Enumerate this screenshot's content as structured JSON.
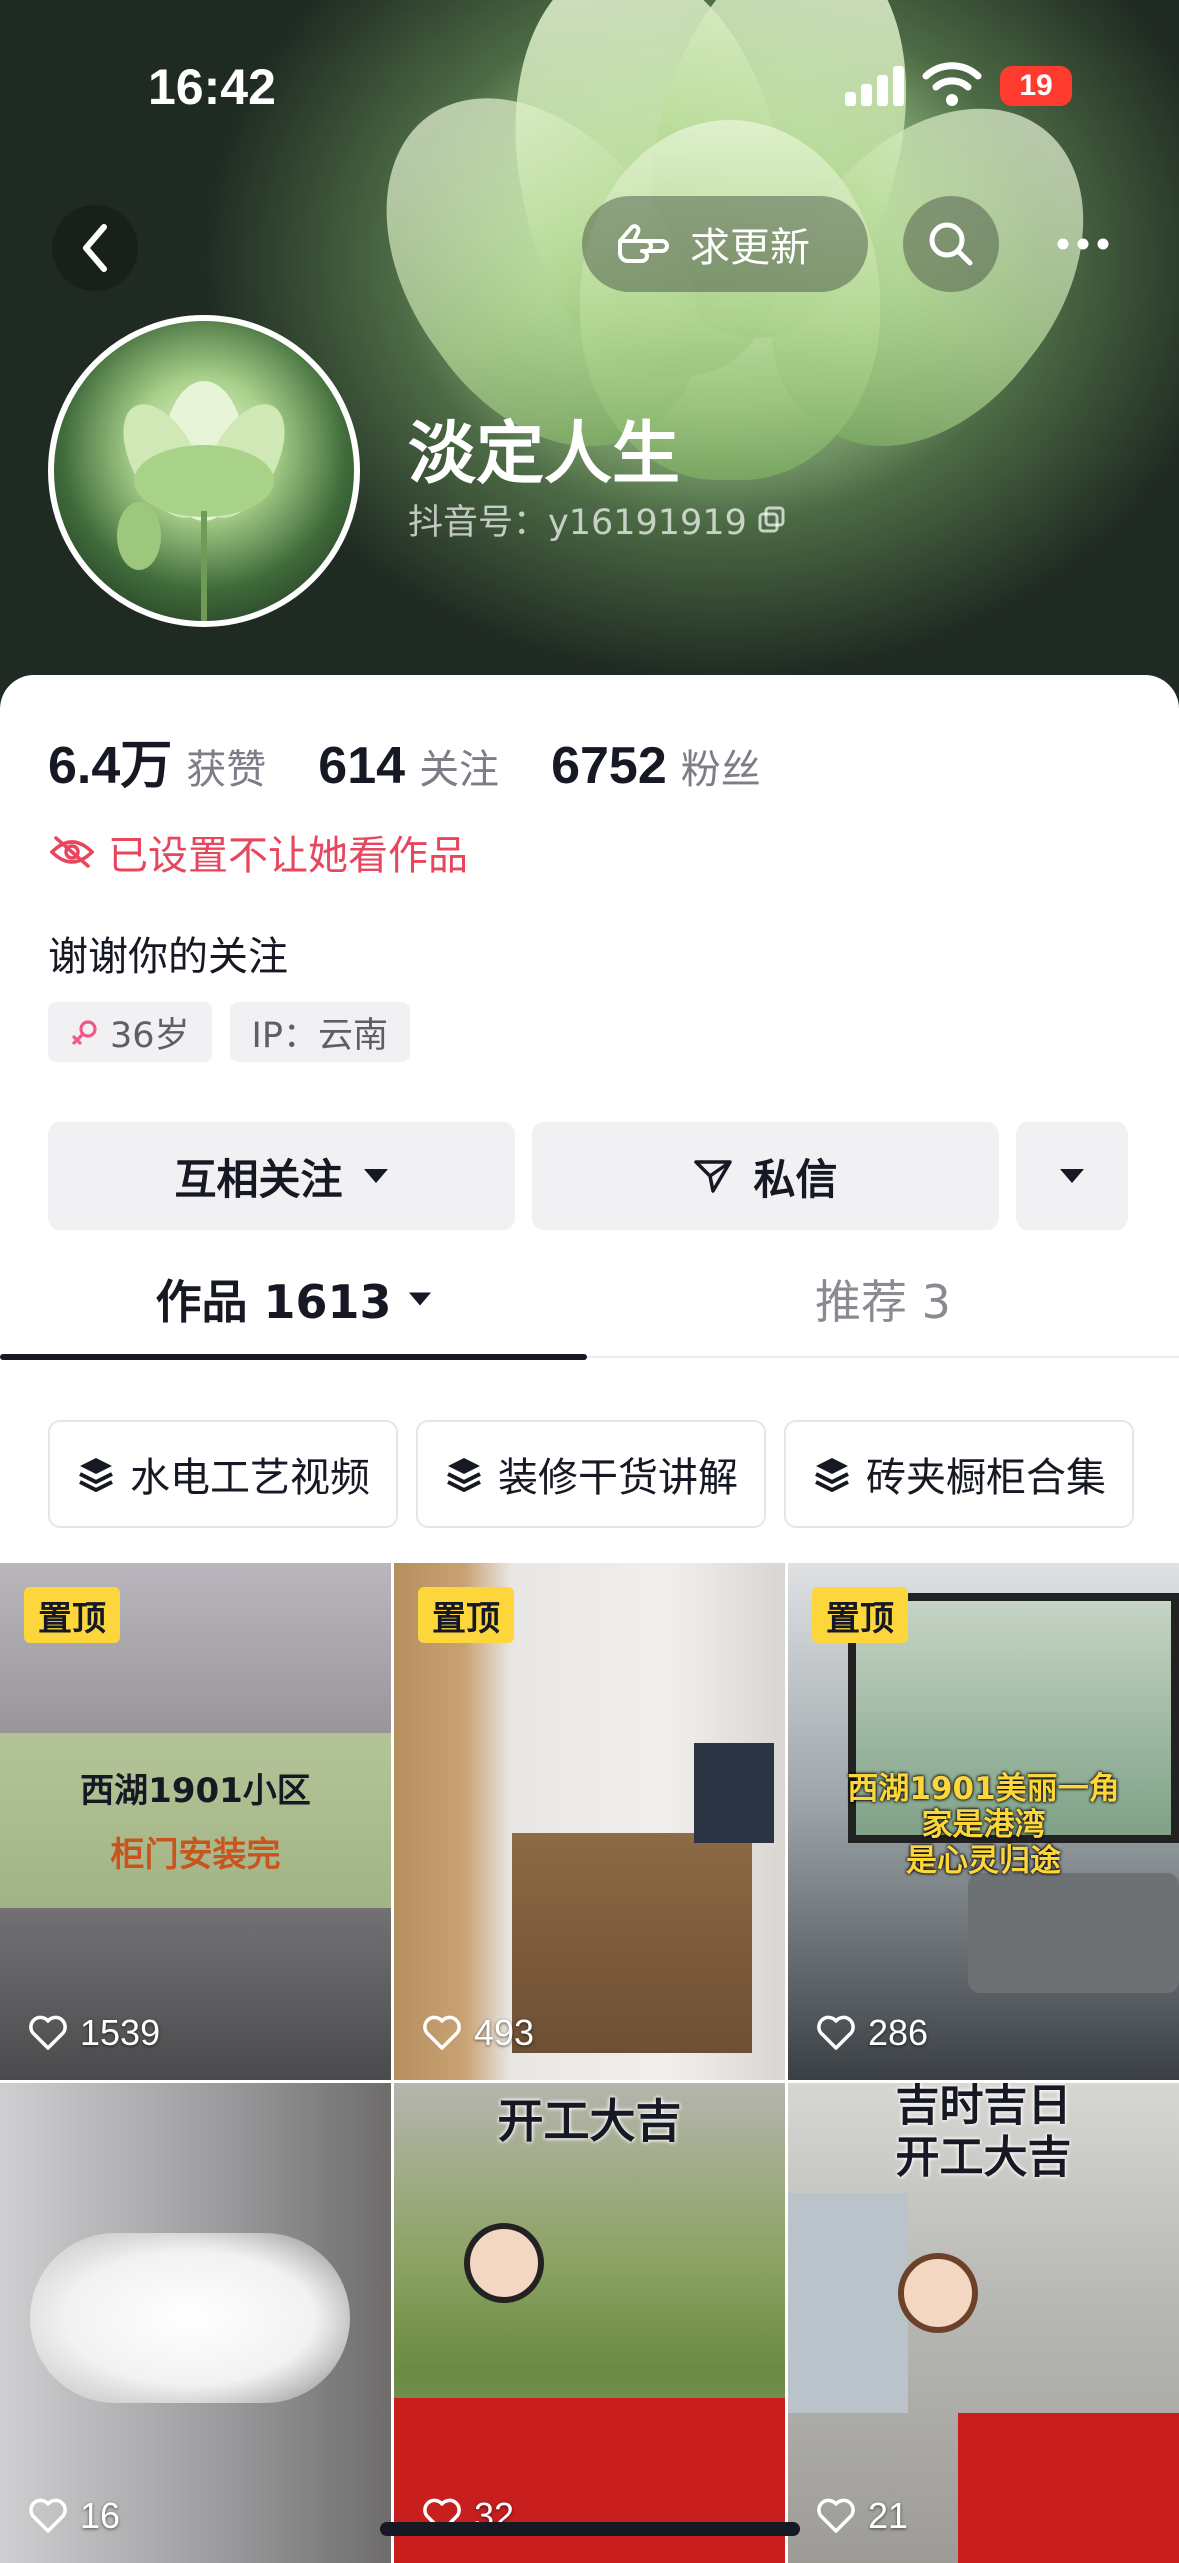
{
  "status_bar": {
    "time": "16:42",
    "battery": "19"
  },
  "nav": {
    "update_label": "求更新"
  },
  "profile": {
    "name": "淡定人生",
    "douyin_id": "抖音号：y16191919",
    "stats": [
      {
        "value": "6.4万",
        "label": "获赞"
      },
      {
        "value": "614",
        "label": "关注"
      },
      {
        "value": "6752",
        "label": "粉丝"
      }
    ],
    "restriction": "已设置不让她看作品",
    "bio": "谢谢你的关注",
    "tags": {
      "age": "36岁",
      "ip": "IP：云南"
    }
  },
  "actions": {
    "follow": "互相关注",
    "message": "私信"
  },
  "tabs": {
    "works": "作品 1613",
    "recommend": "推荐 3"
  },
  "collections": [
    "水电工艺视频",
    "装修干货讲解",
    "砖夹橱柜合集"
  ],
  "videos": [
    {
      "pinned": "置顶",
      "caption1": "西湖1901小区",
      "caption2": "柜门安装完",
      "likes": "1539"
    },
    {
      "pinned": "置顶",
      "likes": "493"
    },
    {
      "pinned": "置顶",
      "caption1": "西湖1901美丽一角",
      "caption2": "家是港湾",
      "caption3": "是心灵归途",
      "likes": "286"
    },
    {
      "likes": "16"
    },
    {
      "caption1": "开工大吉",
      "likes": "32"
    },
    {
      "caption1": "吉时吉日",
      "caption2": "开工大吉",
      "likes": "21"
    }
  ],
  "colors": {
    "accent_red": "#e8465d",
    "pin_yellow": "#fcd63b",
    "text_dark": "#161823",
    "text_gray": "#7c7d86"
  }
}
